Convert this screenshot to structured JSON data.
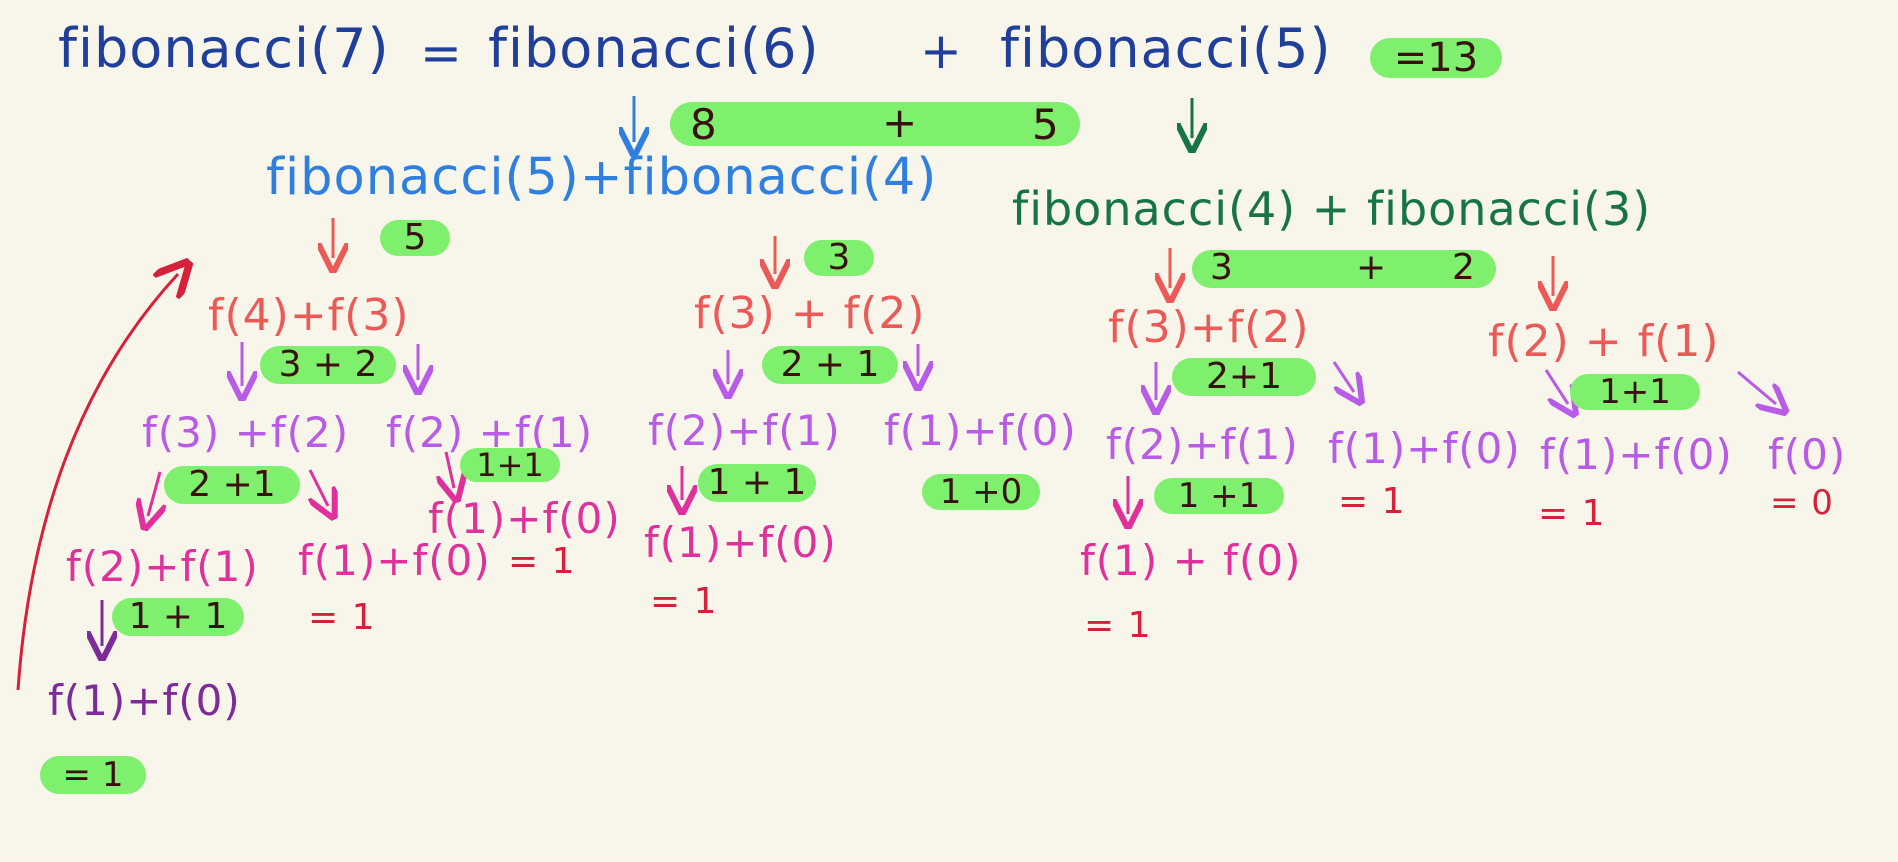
{
  "top": {
    "lhs": "fibonacci(7)",
    "eq": "=",
    "term_a": "fibonacci(6)",
    "plus": "+",
    "term_b": "fibonacci(5)",
    "result": "=13",
    "sum_a": "8",
    "sum_plus": "+",
    "sum_b": "5"
  },
  "level2": {
    "left": "fibonacci(5)+fibonacci(4)",
    "right": "fibonacci(4) + fibonacci(3)",
    "res_a": "5",
    "res_b": "3",
    "res_c_a": "3",
    "res_c_plus": "+",
    "res_c_b": "2"
  },
  "level3": {
    "n1": "f(4)+f(3)",
    "s1": "3 + 2",
    "n2": "f(3) + f(2)",
    "s2": "2 + 1",
    "n3": "f(3)+f(2)",
    "s3": "2+1",
    "n4": "f(2) + f(1)",
    "s4": "1+1"
  },
  "level4": {
    "n1": "f(3) +f(2)",
    "s1": "2 +1",
    "n2": "f(2) +f(1)",
    "s2": "1+1",
    "n3": "f(2)+f(1)",
    "s3": "1 + 1",
    "n4": "f(1)+f(0)",
    "s4": "1 +0",
    "n5": "f(2)+f(1)",
    "s5": "1 +1",
    "n6": "f(1)+f(0)",
    "v6": "= 1",
    "n7": "f(1)+f(0)",
    "v7": "= 1",
    "n8": "f(0)",
    "v8": "= 0"
  },
  "level5": {
    "n1": "f(2)+f(1)",
    "s1": "1 + 1",
    "n2": "f(1)+f(0)",
    "v2": "= 1",
    "n3": "f(1)+f(0)",
    "v3": "= 1",
    "n4": "f(1)+f(0)",
    "v4": "= 1",
    "n5": "f(1) + f(0)",
    "v5": "= 1"
  },
  "level6": {
    "n1": "f(1)+f(0)",
    "v1": "= 1"
  },
  "colors": {
    "navy": "#1f3f9a",
    "blue": "#2f7fe0",
    "green": "#17744a",
    "red": "#ec5a58",
    "violet": "#b85be6",
    "pink": "#e0309c",
    "purple": "#7d2a9a",
    "crimson": "#d6213c",
    "highlight": "#7ef06e"
  }
}
